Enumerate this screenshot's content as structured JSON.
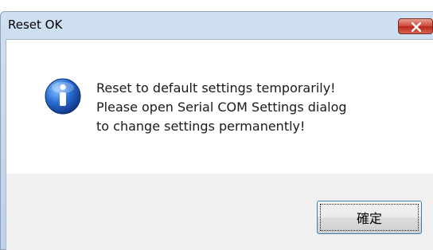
{
  "window": {
    "title": "Reset OK",
    "close_icon": "close-icon"
  },
  "dialog": {
    "icon": "info-icon",
    "message_lines": [
      "Reset to default settings temporarily!",
      "Please open Serial COM Settings dialog",
      "to change settings permanently!"
    ]
  },
  "buttons": {
    "ok_label": "確定"
  },
  "colors": {
    "close_button": "#c9463a",
    "info_icon": "#1f5fc7",
    "button_focus_border": "#3c7fb1"
  }
}
